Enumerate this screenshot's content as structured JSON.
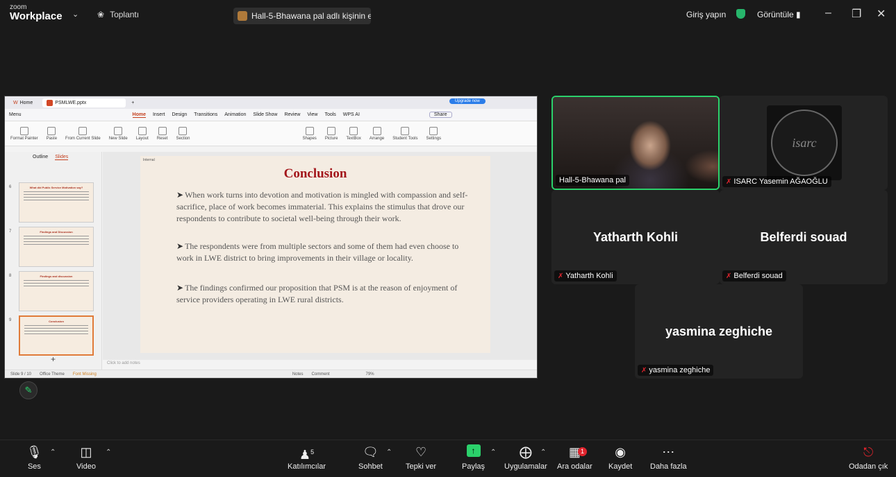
{
  "titlebar": {
    "logo_top": "zoom",
    "logo_bottom": "Workplace",
    "meeting_label": "Toplantı",
    "share_text": "Hall-5-Bhawana pal adlı kişinin e",
    "signin": "Giriş yapın",
    "view_label": "Görüntüle"
  },
  "ppt": {
    "tab_home": "Home",
    "tab_file": "PSMLWE.pptx",
    "upgrade": "Upgrade now",
    "menu": [
      "Menu",
      "Home",
      "Insert",
      "Design",
      "Transitions",
      "Animation",
      "Slide Show",
      "Review",
      "View",
      "Tools",
      "WPS AI"
    ],
    "share_btn": "Share",
    "ribbon": [
      "Format Painter",
      "Paste",
      "From Current Slide",
      "New Slide",
      "Layout",
      "Reset",
      "Section",
      "Shapes",
      "Picture",
      "TextBox",
      "Arrange",
      "Student Tools",
      "Settings"
    ],
    "side_tabs": [
      "Outline",
      "Slides"
    ],
    "slide_nums": [
      "6",
      "7",
      "8",
      "9"
    ],
    "thumb_titles": [
      "What did Public Service Motivation say?",
      "Findings and Discussion",
      "Findings and discussion",
      "Conclusion"
    ],
    "slide_tag": "Internal",
    "slide_title": "Conclusion",
    "bullets": [
      "When work turns into devotion and motivation is mingled with compassion and self-sacrifice, place of work becomes immaterial. This explains the stimulus that drove our respondents to contribute to societal well-being through their work.",
      "The respondents were from multiple sectors and some of them had even choose to work in LWE district to bring improvements in their village or locality.",
      "The findings confirmed our proposition that PSM is at the reason of enjoyment of service providers operating in LWE rural districts."
    ],
    "notes": "Click to add notes",
    "status_slide": "Slide 9 / 10",
    "status_theme": "Office Theme",
    "status_font": "Font Missing",
    "status_notes": "Notes",
    "status_comment": "Comment",
    "status_zoom": "79%"
  },
  "participants": {
    "bhawana": "Hall-5-Bhawana pal",
    "isarc": "ISARC Yasemin AĞAOĞLU",
    "isarc_logo": "isarc",
    "yatharth_big": "Yatharth Kohli",
    "yatharth": "Yatharth Kohli",
    "belferdi_big": "Belferdi souad",
    "belferdi": "Belferdi souad",
    "yasmina_big": "yasmina zeghiche",
    "yasmina": "yasmina zeghiche"
  },
  "toolbar": {
    "audio": "Ses",
    "video": "Video",
    "participants": "Katılımcılar",
    "participants_count": "5",
    "chat": "Sohbet",
    "react": "Tepki ver",
    "share": "Paylaş",
    "apps": "Uygulamalar",
    "breakout": "Ara odalar",
    "breakout_badge": "1",
    "record": "Kaydet",
    "more": "Daha fazla",
    "leave": "Odadan çık"
  },
  "colors": {
    "active_speaker_border": "#2bd16b",
    "muted": "#e0242d",
    "slide_title": "#a3161b"
  }
}
